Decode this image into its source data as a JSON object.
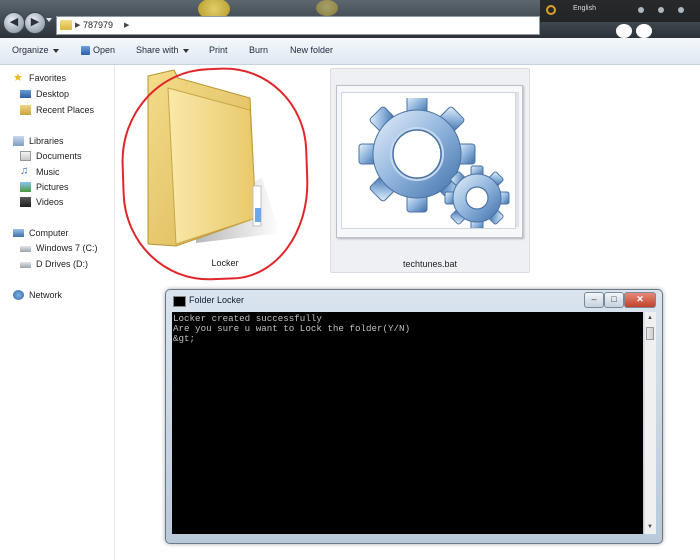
{
  "address_bar": {
    "path": "787979",
    "folder_icon": "folder-icon",
    "arrow_icon": "chevron-right-icon"
  },
  "system_tray": {
    "language": "English"
  },
  "toolbar": {
    "organize": "Organize",
    "open": "Open",
    "share_with": "Share with",
    "print": "Print",
    "burn": "Burn",
    "new_folder": "New folder"
  },
  "sidebar": {
    "favorites": {
      "label": "Favorites",
      "icon": "star-icon",
      "items": [
        {
          "label": "Desktop",
          "icon": "desktop-icon"
        },
        {
          "label": "Recent Places",
          "icon": "recent-places-icon"
        }
      ]
    },
    "libraries": {
      "label": "Libraries",
      "icon": "libraries-icon",
      "items": [
        {
          "label": "Documents",
          "icon": "documents-icon"
        },
        {
          "label": "Music",
          "icon": "music-icon"
        },
        {
          "label": "Pictures",
          "icon": "pictures-icon"
        },
        {
          "label": "Videos",
          "icon": "videos-icon"
        }
      ]
    },
    "computer": {
      "label": "Computer",
      "icon": "computer-icon",
      "items": [
        {
          "label": "Windows 7 (C:)",
          "icon": "drive-icon"
        },
        {
          "label": "D Drives (D:)",
          "icon": "drive-icon"
        }
      ]
    },
    "network": {
      "label": "Network",
      "icon": "network-icon"
    }
  },
  "files": [
    {
      "name": "Locker",
      "icon": "folder-icon",
      "selected": false,
      "annotated": true
    },
    {
      "name": "techtunes.bat",
      "icon": "gears-icon",
      "selected": true
    }
  ],
  "console": {
    "title": "Folder Locker",
    "lines": [
      "Locker created successfully",
      "Are you sure u want to Lock the folder(Y/N)",
      "&gt;"
    ]
  },
  "colors": {
    "annotation": "#e0262b",
    "console_bg": "#000000",
    "console_text": "#c0c0c0",
    "selection": "#eef0f3"
  }
}
